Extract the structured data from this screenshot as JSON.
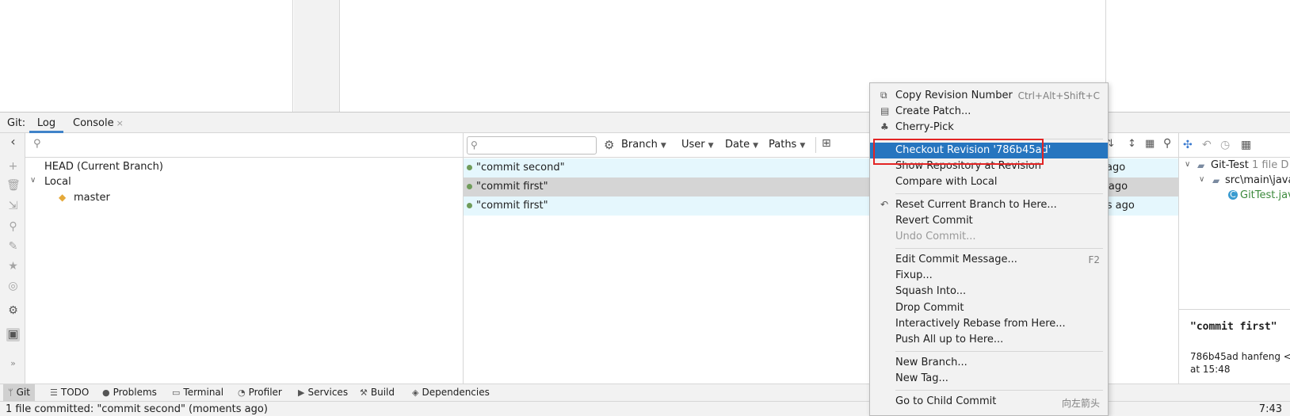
{
  "toolwindow": {
    "title": "Git:",
    "tabs": [
      {
        "label": "Log",
        "active": true
      },
      {
        "label": "Console",
        "closable": true
      }
    ],
    "close_glyph": "×"
  },
  "branches": {
    "items": [
      "HEAD (Current Branch)",
      "Local",
      "master"
    ]
  },
  "log_toolbar": {
    "filters": [
      "Branch",
      "User",
      "Date",
      "Paths"
    ]
  },
  "commits": [
    {
      "message": "\"commit second\"",
      "date": "ts ago"
    },
    {
      "message": "\"commit first\"",
      "date": "es ago"
    },
    {
      "message": "\"commit first\"",
      "date": "ites ago"
    }
  ],
  "details": {
    "tree": [
      "Git-Test",
      "1 file",
      "D",
      "src\\main\\java",
      "GitTest.java"
    ],
    "commit_title": "\"commit first\"",
    "hash_line": "786b45ad hanfeng <",
    "time_line": "at 15:48"
  },
  "context_menu": {
    "items": [
      {
        "label": "Copy Revision Number",
        "shortcut": "Ctrl+Alt+Shift+C",
        "icon": "copy-icon"
      },
      {
        "label": "Create Patch...",
        "icon": "patch-icon"
      },
      {
        "label": "Cherry-Pick",
        "icon": "cherry-icon"
      },
      {
        "label": "Checkout Revision '786b45ad'",
        "selected": true
      },
      {
        "label": "Show Repository at Revision"
      },
      {
        "label": "Compare with Local"
      },
      {
        "label": "Reset Current Branch to Here...",
        "icon": "undo-icon"
      },
      {
        "label": "Revert Commit"
      },
      {
        "label": "Undo Commit...",
        "disabled": true
      },
      {
        "label": "Edit Commit Message...",
        "shortcut": "F2"
      },
      {
        "label": "Fixup..."
      },
      {
        "label": "Squash Into..."
      },
      {
        "label": "Drop Commit"
      },
      {
        "label": "Interactively Rebase from Here..."
      },
      {
        "label": "Push All up to Here..."
      },
      {
        "label": "New Branch..."
      },
      {
        "label": "New Tag..."
      },
      {
        "label": "Go to Child Commit",
        "shortcut": "向左箭头"
      }
    ]
  },
  "bottom_tabs": [
    "Git",
    "TODO",
    "Problems",
    "Terminal",
    "Profiler",
    "Services",
    "Build",
    "Dependencies"
  ],
  "status": {
    "message": "1 file committed: \"commit second\" (moments ago)",
    "position": "7:43"
  },
  "colors": {
    "selection": "#2675bf",
    "commit_row_highlight": "#e5f7fd",
    "commit_row_selected": "#d5d5d5",
    "graph_node": "#6f9c5a",
    "annotation_box": "#e32424"
  }
}
